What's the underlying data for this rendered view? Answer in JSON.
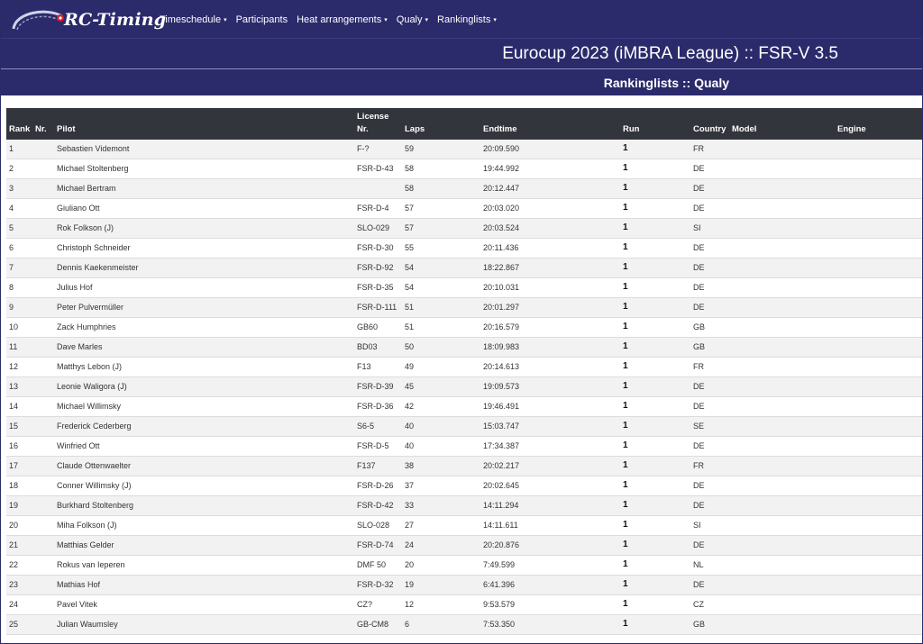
{
  "brand": {
    "name": "RC-Timing"
  },
  "nav": {
    "items": [
      {
        "label": "Timeschedule",
        "has_dropdown": true
      },
      {
        "label": "Participants",
        "has_dropdown": false
      },
      {
        "label": "Heat arrangements",
        "has_dropdown": true
      },
      {
        "label": "Qualy",
        "has_dropdown": true
      },
      {
        "label": "Rankinglists",
        "has_dropdown": true
      }
    ]
  },
  "event_title": "Eurocup 2023 (iMBRA League) :: FSR-V 3.5",
  "page_subtitle": "Rankinglists :: Qualy",
  "table": {
    "headers": {
      "rank": "Rank",
      "nr": "Nr.",
      "pilot": "Pilot",
      "license": "License Nr.",
      "laps": "Laps",
      "endtime": "Endtime",
      "run": "Run",
      "country": "Country",
      "model": "Model",
      "engine": "Engine"
    },
    "rows": [
      {
        "rank": "1",
        "nr": "",
        "pilot": "Sebastien Videmont",
        "license": "F-?",
        "laps": "59",
        "endtime": "20:09.590",
        "run": "1",
        "country": "FR",
        "model": "",
        "engine": ""
      },
      {
        "rank": "2",
        "nr": "",
        "pilot": "Michael Stoltenberg",
        "license": "FSR-D-43",
        "laps": "58",
        "endtime": "19:44.992",
        "run": "1",
        "country": "DE",
        "model": "",
        "engine": ""
      },
      {
        "rank": "3",
        "nr": "",
        "pilot": "Michael Bertram",
        "license": "",
        "laps": "58",
        "endtime": "20:12.447",
        "run": "1",
        "country": "DE",
        "model": "",
        "engine": ""
      },
      {
        "rank": "4",
        "nr": "",
        "pilot": "Giuliano Ott",
        "license": "FSR-D-4",
        "laps": "57",
        "endtime": "20:03.020",
        "run": "1",
        "country": "DE",
        "model": "",
        "engine": ""
      },
      {
        "rank": "5",
        "nr": "",
        "pilot": "Rok Folkson (J)",
        "license": "SLO-029",
        "laps": "57",
        "endtime": "20:03.524",
        "run": "1",
        "country": "SI",
        "model": "",
        "engine": ""
      },
      {
        "rank": "6",
        "nr": "",
        "pilot": "Christoph Schneider",
        "license": "FSR-D-30",
        "laps": "55",
        "endtime": "20:11.436",
        "run": "1",
        "country": "DE",
        "model": "",
        "engine": ""
      },
      {
        "rank": "7",
        "nr": "",
        "pilot": "Dennis Kaekenmeister",
        "license": "FSR-D-92",
        "laps": "54",
        "endtime": "18:22.867",
        "run": "1",
        "country": "DE",
        "model": "",
        "engine": ""
      },
      {
        "rank": "8",
        "nr": "",
        "pilot": "Julius Hof",
        "license": "FSR-D-35",
        "laps": "54",
        "endtime": "20:10.031",
        "run": "1",
        "country": "DE",
        "model": "",
        "engine": ""
      },
      {
        "rank": "9",
        "nr": "",
        "pilot": "Peter Pulvermüller",
        "license": "FSR-D-111",
        "laps": "51",
        "endtime": "20:01.297",
        "run": "1",
        "country": "DE",
        "model": "",
        "engine": "",
        "wrap": true
      },
      {
        "rank": "10",
        "nr": "",
        "pilot": "Zack Humphries",
        "license": "GB60",
        "laps": "51",
        "endtime": "20:16.579",
        "run": "1",
        "country": "GB",
        "model": "",
        "engine": ""
      },
      {
        "rank": "11",
        "nr": "",
        "pilot": "Dave Marles",
        "license": "BD03",
        "laps": "50",
        "endtime": "18:09.983",
        "run": "1",
        "country": "GB",
        "model": "",
        "engine": ""
      },
      {
        "rank": "12",
        "nr": "",
        "pilot": "Matthys Lebon (J)",
        "license": "F13",
        "laps": "49",
        "endtime": "20:14.613",
        "run": "1",
        "country": "FR",
        "model": "",
        "engine": ""
      },
      {
        "rank": "13",
        "nr": "",
        "pilot": "Leonie Waligora (J)",
        "license": "FSR-D-39",
        "laps": "45",
        "endtime": "19:09.573",
        "run": "1",
        "country": "DE",
        "model": "",
        "engine": ""
      },
      {
        "rank": "14",
        "nr": "",
        "pilot": "Michael Willimsky",
        "license": "FSR-D-36",
        "laps": "42",
        "endtime": "19:46.491",
        "run": "1",
        "country": "DE",
        "model": "",
        "engine": ""
      },
      {
        "rank": "15",
        "nr": "",
        "pilot": "Frederick Cederberg",
        "license": "S6-5",
        "laps": "40",
        "endtime": "15:03.747",
        "run": "1",
        "country": "SE",
        "model": "",
        "engine": ""
      },
      {
        "rank": "16",
        "nr": "",
        "pilot": "Winfried Ott",
        "license": "FSR-D-5",
        "laps": "40",
        "endtime": "17:34.387",
        "run": "1",
        "country": "DE",
        "model": "",
        "engine": ""
      },
      {
        "rank": "17",
        "nr": "",
        "pilot": "Claude Ottenwaelter",
        "license": "F137",
        "laps": "38",
        "endtime": "20:02.217",
        "run": "1",
        "country": "FR",
        "model": "",
        "engine": ""
      },
      {
        "rank": "18",
        "nr": "",
        "pilot": "Conner Willimsky (J)",
        "license": "FSR-D-26",
        "laps": "37",
        "endtime": "20:02.645",
        "run": "1",
        "country": "DE",
        "model": "",
        "engine": ""
      },
      {
        "rank": "19",
        "nr": "",
        "pilot": "Burkhard Stoltenberg",
        "license": "FSR-D-42",
        "laps": "33",
        "endtime": "14:11.294",
        "run": "1",
        "country": "DE",
        "model": "",
        "engine": ""
      },
      {
        "rank": "20",
        "nr": "",
        "pilot": "Miha Folkson (J)",
        "license": "SLO-028",
        "laps": "27",
        "endtime": "14:11.611",
        "run": "1",
        "country": "SI",
        "model": "",
        "engine": ""
      },
      {
        "rank": "21",
        "nr": "",
        "pilot": "Matthias Gelder",
        "license": "FSR-D-74",
        "laps": "24",
        "endtime": "20:20.876",
        "run": "1",
        "country": "DE",
        "model": "",
        "engine": ""
      },
      {
        "rank": "22",
        "nr": "",
        "pilot": "Rokus van Ieperen",
        "license": "DMF 50",
        "laps": "20",
        "endtime": "7:49.599",
        "run": "1",
        "country": "NL",
        "model": "",
        "engine": ""
      },
      {
        "rank": "23",
        "nr": "",
        "pilot": "Mathias Hof",
        "license": "FSR-D-32",
        "laps": "19",
        "endtime": "6:41.396",
        "run": "1",
        "country": "DE",
        "model": "",
        "engine": ""
      },
      {
        "rank": "24",
        "nr": "",
        "pilot": "Pavel Vitek",
        "license": "CZ?",
        "laps": "12",
        "endtime": "9:53.579",
        "run": "1",
        "country": "CZ",
        "model": "",
        "engine": ""
      },
      {
        "rank": "25",
        "nr": "",
        "pilot": "Julian Waumsley",
        "license": "GB-CM8",
        "laps": "6",
        "endtime": "7:53.350",
        "run": "1",
        "country": "GB",
        "model": "",
        "engine": ""
      }
    ]
  },
  "colors": {
    "header_bg": "#2b2a6b",
    "table_header_bg": "#33353c",
    "stripe": "#f2f2f2"
  }
}
